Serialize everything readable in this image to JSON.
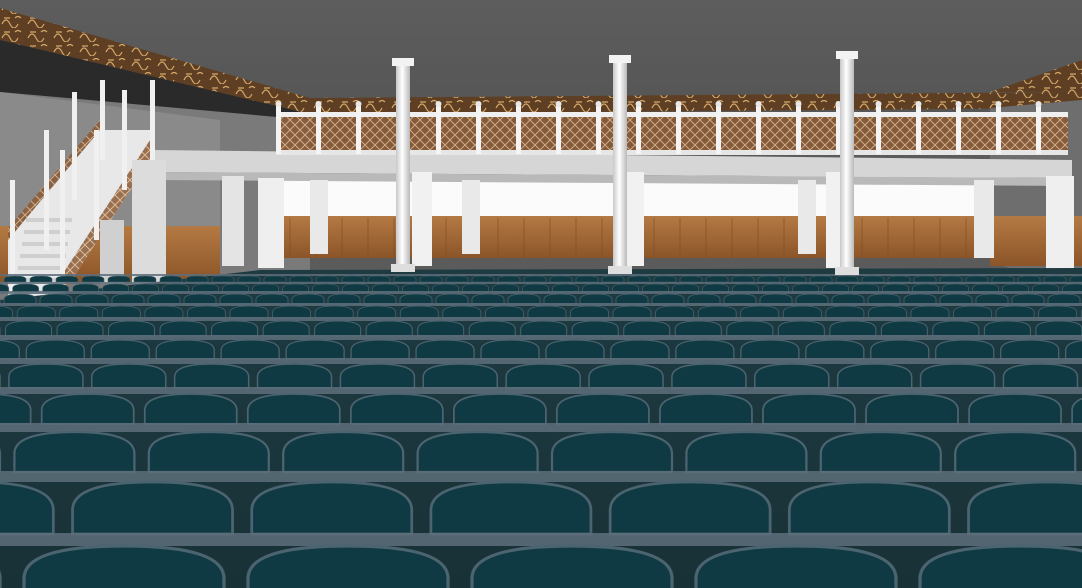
{
  "scene": {
    "colors": {
      "ceiling": "#595959",
      "frieze": "#6b4a2a",
      "frieze_script": "#c79a5a",
      "wall_white": "#fafafa",
      "wood_panel": "#a86a36",
      "wood_dark": "#7c4a22",
      "column": "#e9e9e9",
      "column_shadow": "#bdbdbd",
      "balcony": "#dcdcdc",
      "railing": "#eeeeee",
      "lattice": "#8a5a36",
      "carpet_base": "#1f3f45",
      "carpet_arch": "#0e3b44",
      "carpet_band": "#5d6f7a"
    }
  }
}
